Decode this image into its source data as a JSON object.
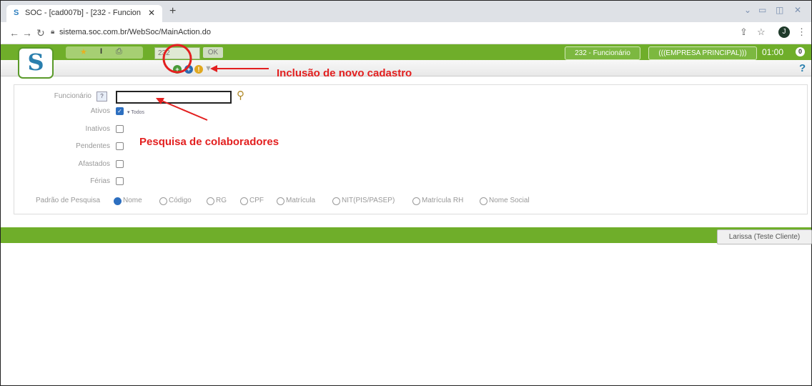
{
  "browser": {
    "tab_title": "SOC - [cad007b] - [232 - Funcion",
    "tab_close": "✕",
    "new_tab": "+",
    "url": "sistema.soc.com.br/WebSoc/MainAction.do",
    "avatar_letter": "J"
  },
  "header": {
    "code_value": "232",
    "ok_label": "OK",
    "screen_label": "232 - Funcionário",
    "company_label": "(((EMPRESA PRINCIPAL)))",
    "clock": "01:00",
    "badge_count": "0"
  },
  "form": {
    "funcionario_label": "Funcionário",
    "help_btn": "?",
    "ativos_label": "Ativos",
    "todos_label": "▾ Todos",
    "inativos_label": "Inativos",
    "pendentes_label": "Pendentes",
    "afastados_label": "Afastados",
    "ferias_label": "Férias",
    "padrao_label": "Padrão de Pesquisa",
    "options": [
      "Nome",
      "Código",
      "RG",
      "CPF",
      "Matrícula",
      "NIT(PIS/PASEP)",
      "Matrícula RH",
      "Nome Social"
    ],
    "selected_option": "Nome"
  },
  "footer": {
    "user_button": "Larissa (Teste Cliente)"
  },
  "annotations": {
    "new_record": "Inclusão de novo cadastro",
    "search_employees": "Pesquisa de colaboradores"
  },
  "colors": {
    "green_bar": "#6fae2a",
    "annotation_red": "#e32020",
    "logo_blue": "#2a7fae"
  }
}
